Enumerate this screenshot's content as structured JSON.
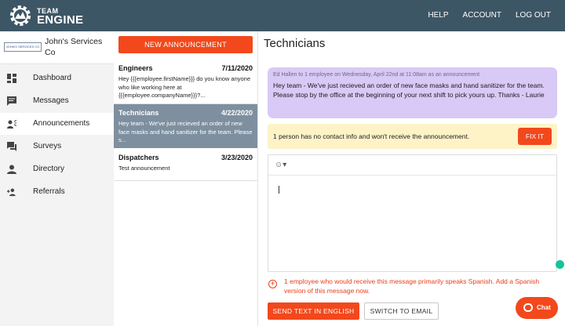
{
  "brand": {
    "line1": "TEAM",
    "line2": "ENGINE"
  },
  "topnav": {
    "help": "HELP",
    "account": "ACCOUNT",
    "logout": "LOG OUT"
  },
  "org": {
    "logo_text": "JOHN'S SERVICES CO",
    "name": "John's Services Co"
  },
  "sidebar": {
    "items": [
      {
        "label": "Dashboard",
        "icon": "dashboard-icon"
      },
      {
        "label": "Messages",
        "icon": "message-icon"
      },
      {
        "label": "Announcements",
        "icon": "megaphone-icon",
        "active": true
      },
      {
        "label": "Surveys",
        "icon": "survey-icon"
      },
      {
        "label": "Directory",
        "icon": "person-icon"
      },
      {
        "label": "Referrals",
        "icon": "add-person-icon"
      }
    ]
  },
  "list": {
    "new_button": "NEW ANNOUNCEMENT",
    "items": [
      {
        "name": "Engineers",
        "date": "7/11/2020",
        "preview": "Hey {{{employee.firstName}}} do you know anyone who like working here at {{{employee.companyName}}}?..."
      },
      {
        "name": "Technicians",
        "date": "4/22/2020",
        "preview": "Hey team - We've just recieved an order of new face masks and hand sanitizer for the team. Please s..."
      },
      {
        "name": "Dispatchers",
        "date": "3/23/2020",
        "preview": "Test announcement"
      }
    ]
  },
  "main": {
    "title": "Technicians",
    "message": {
      "meta": "Ed Hallen to 1 employee on Wednesday, April 22nd at 11:08am as an announcement",
      "body": "Hey team - We've just recieved an order of new face masks and hand sanitizer for the team. Please stop by the office at the beginning of your next shift to pick yours up.  Thanks - Laurie"
    },
    "warning": {
      "text": "1 person has no contact info and won't receive the announcement.",
      "fix_label": "FIX IT"
    },
    "composer": {
      "emoji": "☺▾",
      "value": ""
    },
    "spanish_notice": "1 employee who would receive this message primarily speaks Spanish. Add a Spanish version of this message now.",
    "send_label": "SEND TEXT IN ENGLISH",
    "switch_label": "SWITCH TO EMAIL"
  },
  "chat": {
    "label": "Chat"
  },
  "colors": {
    "header": "#3d5665",
    "accent": "#f2481c",
    "message_bg": "#d8c9f6",
    "warning_bg": "#fdf3c7",
    "selected_row": "#7e8f9f"
  }
}
